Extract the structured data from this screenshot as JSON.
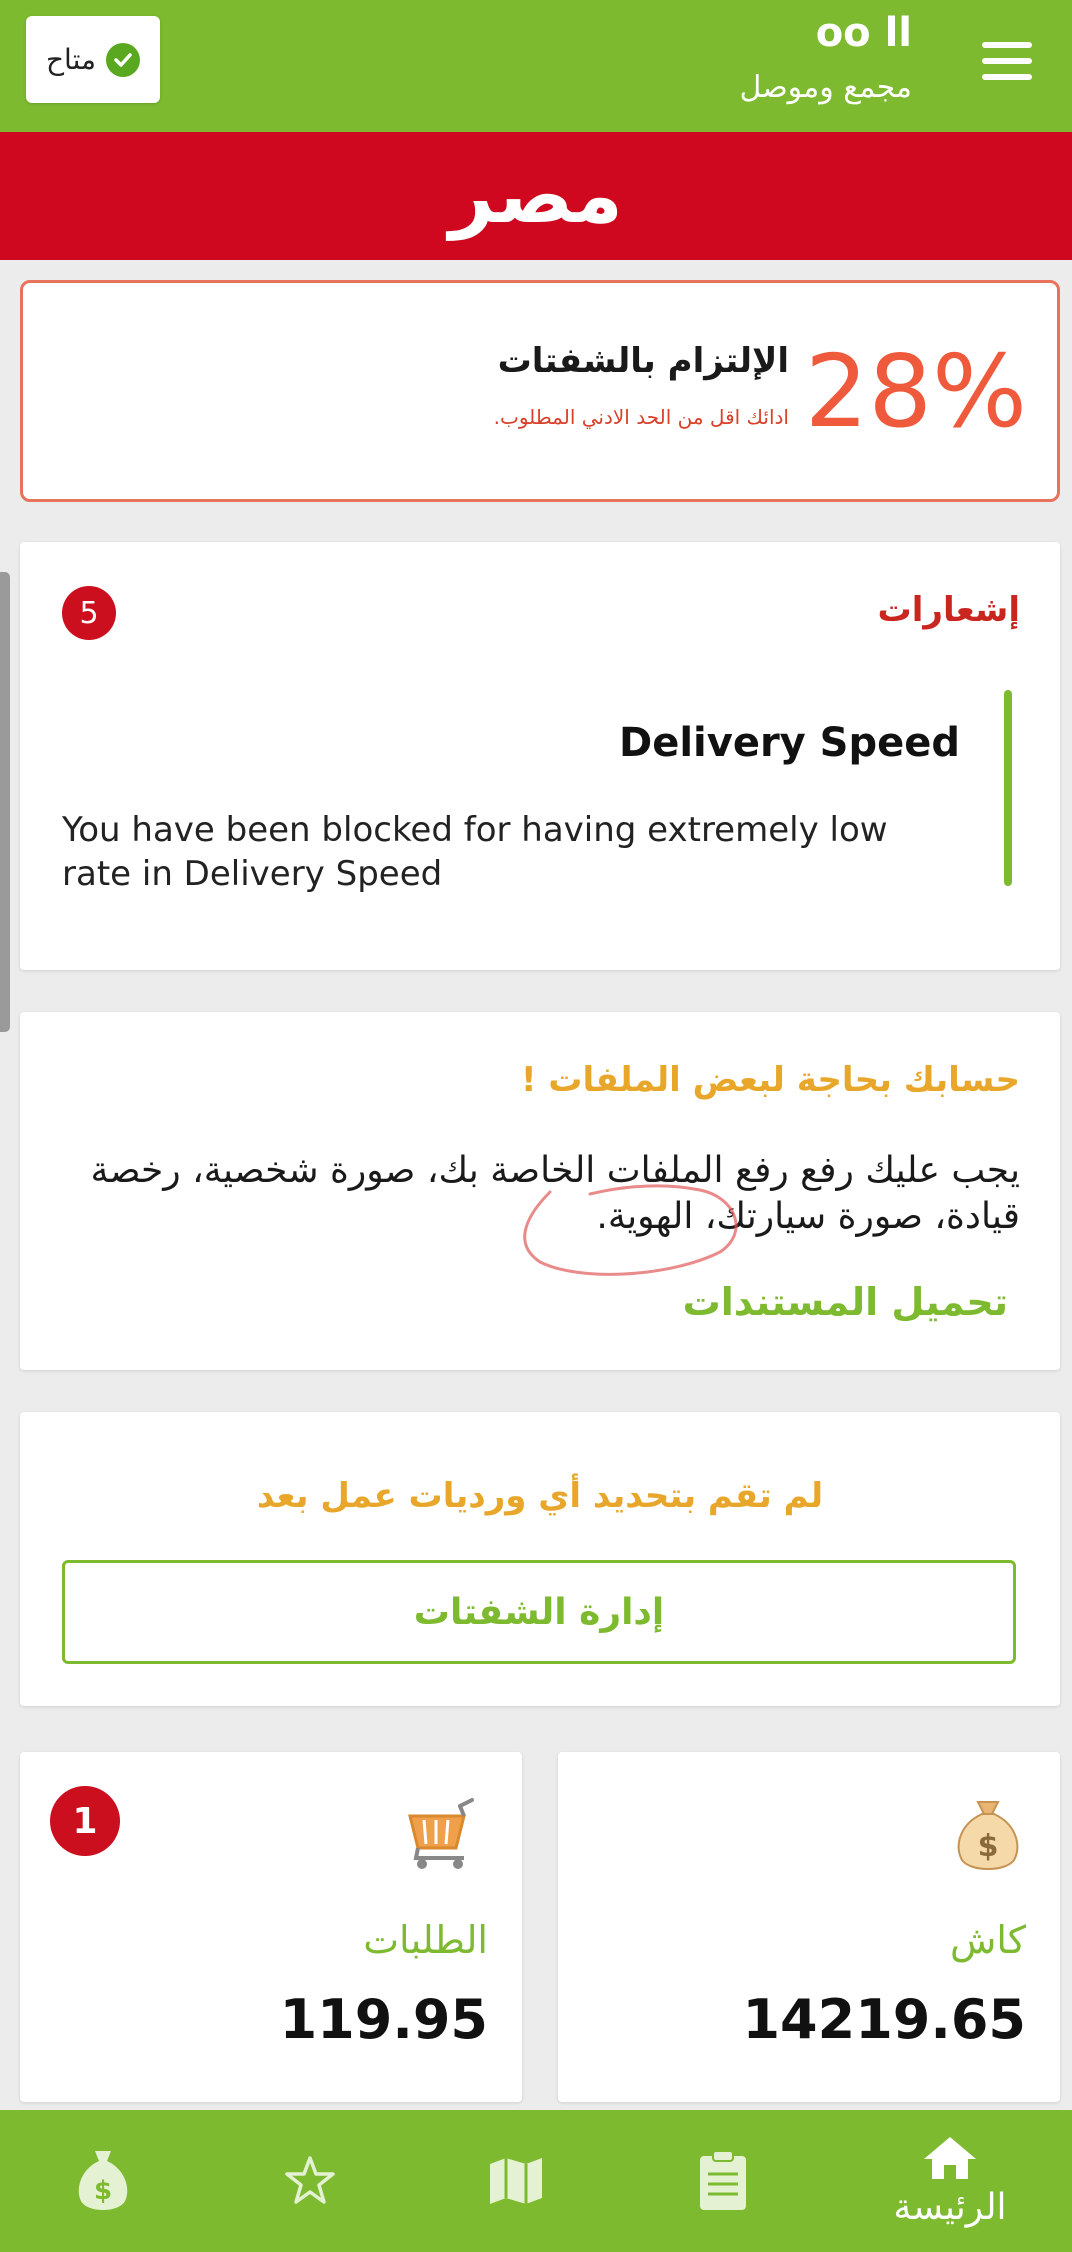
{
  "header": {
    "status_label": "متاح",
    "user_name": "oo ll",
    "user_subtitle": "مجمع وموصل"
  },
  "banner": {
    "country": "مصر"
  },
  "commitment": {
    "percent": "28%",
    "title": "الإلتزام بالشفتات",
    "subtitle": "ادائك اقل من الحد الادني المطلوب."
  },
  "notifications": {
    "title": "إشعارات",
    "count": "5",
    "items": [
      {
        "title": "Delivery Speed",
        "body": "You have been blocked for having extremely low rate in Delivery Speed"
      }
    ]
  },
  "documents": {
    "title": "حسابك بحاجة لبعض الملفات !",
    "body": "يجب عليك رفع رفع الملفات الخاصة بك، صورة شخصية، رخصة قيادة، صورة سيارتك، الهوية.",
    "link": "تحميل المستندات"
  },
  "shifts": {
    "message": "لم تقم بتحديد أي ورديات عمل بعد",
    "button": "إدارة الشفتات"
  },
  "stats": {
    "orders": {
      "label": "الطلبات",
      "value": "119.95",
      "badge": "1",
      "icon": "cart-icon"
    },
    "cash": {
      "label": "كاش",
      "value": "14219.65",
      "icon": "money-bag-icon"
    }
  },
  "nav": {
    "home_label": "الرئيسة",
    "items": [
      "home-icon",
      "clipboard-icon",
      "map-icon",
      "star-icon",
      "money-bag-icon"
    ]
  },
  "colors": {
    "brand_green": "#7dba2f",
    "banner_red": "#d0081f",
    "alert_orange": "#ef5a3c",
    "warning_yellow": "#e8a72a"
  }
}
